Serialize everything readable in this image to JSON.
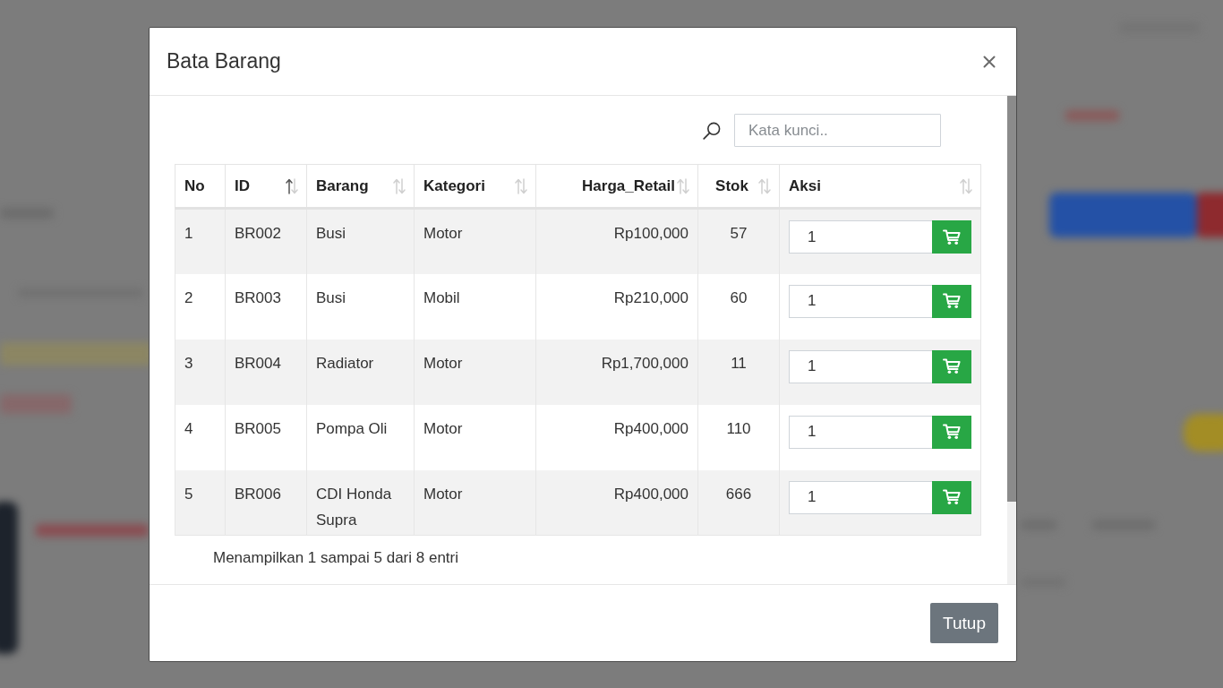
{
  "modal": {
    "title": "Bata Barang"
  },
  "search": {
    "placeholder": "Kata kunci.."
  },
  "table": {
    "columns": [
      {
        "label": "No",
        "kind": "index",
        "sortable": false,
        "sorted": false
      },
      {
        "label": "ID",
        "kind": "text",
        "sortable": true,
        "sorted": true
      },
      {
        "label": "Barang",
        "kind": "text",
        "sortable": true,
        "sorted": false
      },
      {
        "label": "Kategori",
        "kind": "text",
        "sortable": true,
        "sorted": false
      },
      {
        "label": "Harga_Retail",
        "kind": "money",
        "sortable": true,
        "sorted": false
      },
      {
        "label": "Stok",
        "kind": "count",
        "sortable": true,
        "sorted": false
      },
      {
        "label": "Aksi",
        "kind": "action",
        "sortable": true,
        "sorted": false
      }
    ],
    "rows": [
      {
        "cells": [
          "1",
          "BR002",
          "Busi",
          "Motor",
          "Rp100,000",
          "57"
        ],
        "quantity": "1"
      },
      {
        "cells": [
          "2",
          "BR003",
          "Busi",
          "Mobil",
          "Rp210,000",
          "60"
        ],
        "quantity": "1"
      },
      {
        "cells": [
          "3",
          "BR004",
          "Radiator",
          "Motor",
          "Rp1,700,000",
          "11"
        ],
        "quantity": "1"
      },
      {
        "cells": [
          "4",
          "BR005",
          "Pompa Oli",
          "Motor",
          "Rp400,000",
          "110"
        ],
        "quantity": "1"
      },
      {
        "cells": [
          "5",
          "BR006",
          "CDI Honda Supra",
          "Motor",
          "Rp400,000",
          "666"
        ],
        "quantity": "1"
      }
    ]
  },
  "info": "Menampilkan 1 sampai 5 dari 8 entri",
  "footer": {
    "buttons": [
      "Tutup"
    ]
  }
}
